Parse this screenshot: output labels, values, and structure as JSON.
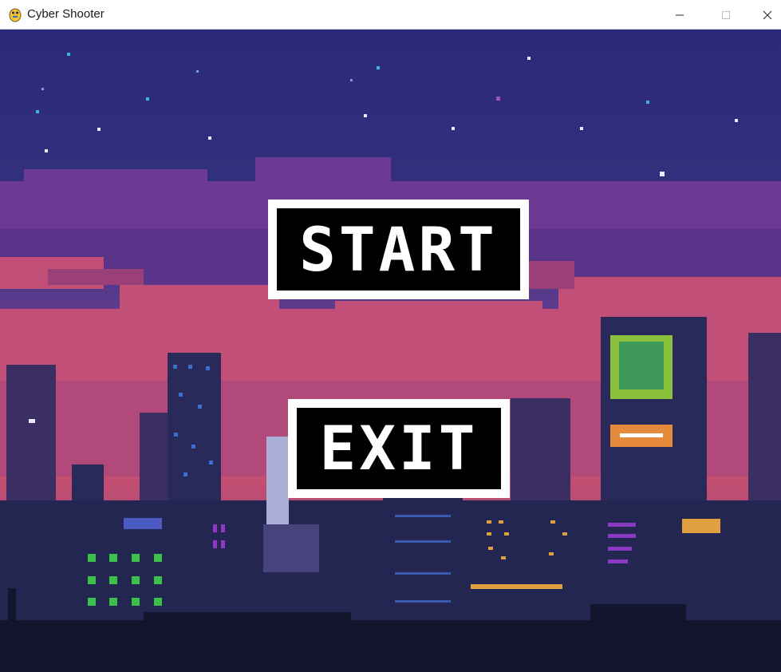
{
  "window": {
    "title": "Cyber Shooter",
    "app_icon": "pygame-snake-icon",
    "controls": {
      "minimize_icon": "minimize-icon",
      "maximize_icon": "maximize-icon",
      "close_icon": "close-icon"
    }
  },
  "menu": {
    "start_label": "START",
    "exit_label": "EXIT"
  },
  "background": {
    "description_icon": "pixel-city-skyline-icon",
    "colors": {
      "sky_top": "#2b2a78",
      "clouds": "#6e3a93",
      "sunset": "#c64a73",
      "buildings": "#262a55",
      "foreground": "#12152c"
    }
  }
}
